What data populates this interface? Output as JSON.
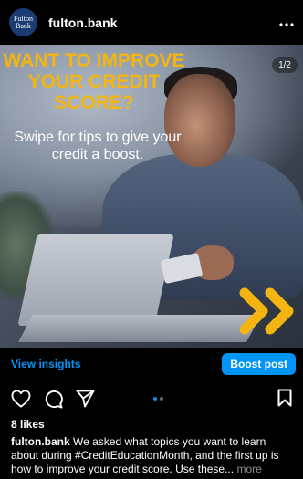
{
  "account": {
    "username": "fulton.bank",
    "avatar_text_line1": "Fulton",
    "avatar_text_line2": "Bank",
    "menu_icon": "more-horizontal-icon"
  },
  "post": {
    "headline": "WANT TO IMPROVE YOUR CREDIT SCORE?",
    "subline": "Swipe for tips to give your credit a boost.",
    "counter": "1/2",
    "current_slide": 1,
    "total_slides": 2,
    "chevron_icon": "double-chevron-right-icon",
    "colors": {
      "headline": "#f4b512",
      "chevrons": "#f4b512",
      "accent": "#0095f6"
    }
  },
  "insights": {
    "view_label": "View insights",
    "boost_label": "Boost post"
  },
  "actions": {
    "like_icon": "heart-icon",
    "comment_icon": "comment-icon",
    "share_icon": "send-icon",
    "save_icon": "bookmark-icon"
  },
  "engagement": {
    "likes": "8 likes"
  },
  "caption": {
    "username": "fulton.bank",
    "text": "We asked what topics you want to learn about during #CreditEducationMonth, and the first up is how to improve your credit score. Use these...",
    "more_label": "more"
  }
}
